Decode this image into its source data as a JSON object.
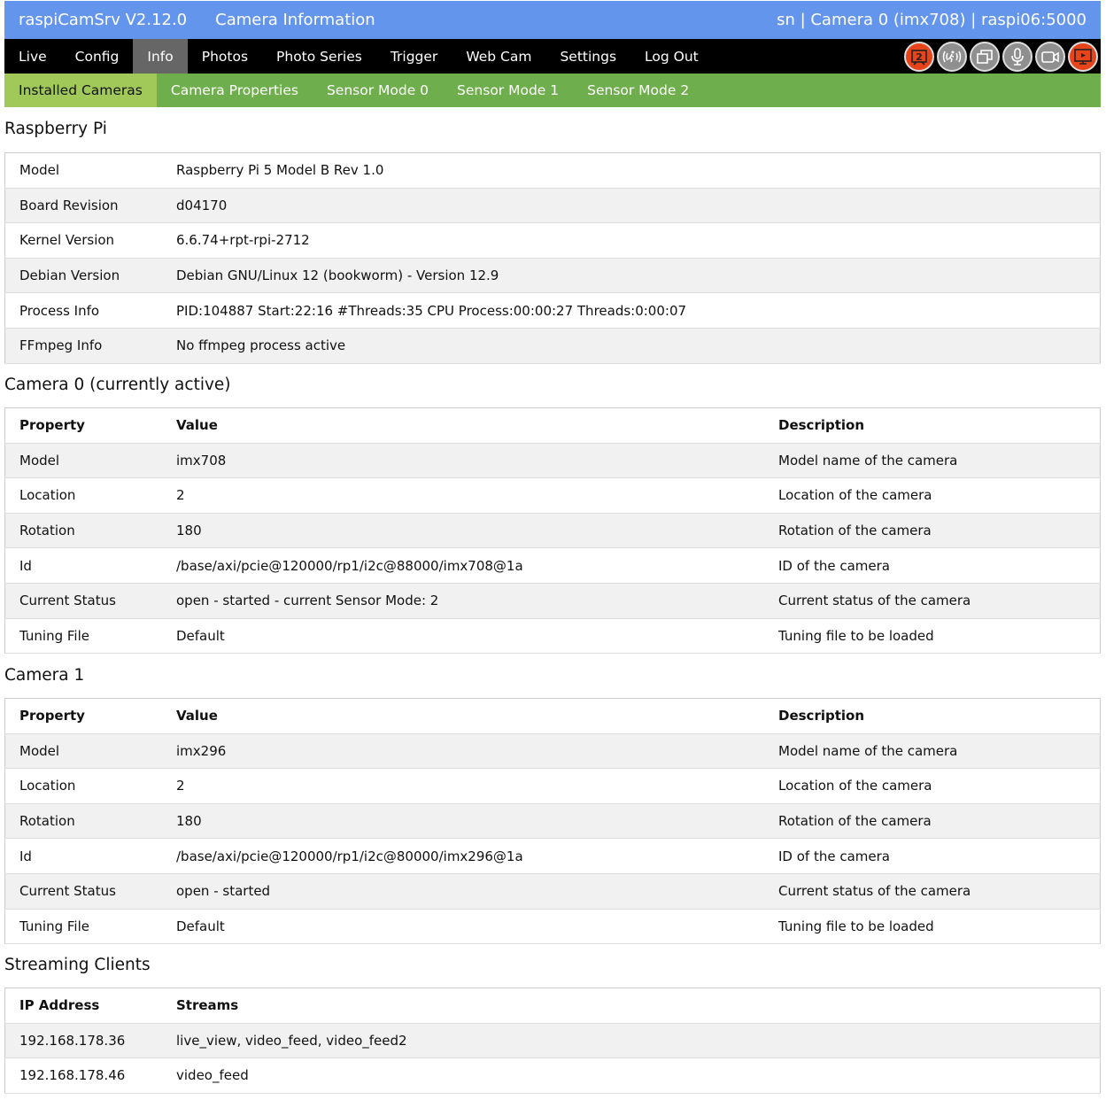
{
  "header": {
    "app_title": "raspiCamSrv V2.12.0",
    "page_title": "Camera Information",
    "status": "sn | Camera 0 (imx708) | raspi06:5000"
  },
  "nav": {
    "items": [
      "Live",
      "Config",
      "Info",
      "Photos",
      "Photo Series",
      "Trigger",
      "Web Cam",
      "Settings",
      "Log Out"
    ],
    "active": "Info",
    "icons": [
      "camera-count-2-icon",
      "motion-trigger-icon",
      "multi-camera-icon",
      "microphone-icon",
      "video-recording-icon",
      "streaming-screen-icon"
    ],
    "icon_badge": "2",
    "colors": {
      "red": "#e8441a",
      "gray": "#8f8f8f"
    }
  },
  "subnav": {
    "items": [
      "Installed Cameras",
      "Camera Properties",
      "Sensor Mode 0",
      "Sensor Mode 1",
      "Sensor Mode 2"
    ],
    "active": "Installed Cameras"
  },
  "raspberry_pi": {
    "title": "Raspberry Pi",
    "rows": [
      [
        "Model",
        "Raspberry Pi 5 Model B Rev 1.0"
      ],
      [
        "Board Revision",
        "d04170"
      ],
      [
        "Kernel Version",
        "6.6.74+rpt-rpi-2712"
      ],
      [
        "Debian Version",
        "Debian GNU/Linux 12 (bookworm) - Version 12.9"
      ],
      [
        "Process Info",
        "PID:104887 Start:22:16 #Threads:35 CPU Process:00:00:27 Threads:0:00:07"
      ],
      [
        "FFmpeg Info",
        "No ffmpeg process active"
      ]
    ]
  },
  "camera0": {
    "title": "Camera 0 (currently active)",
    "headers": [
      "Property",
      "Value",
      "Description"
    ],
    "rows": [
      [
        "Model",
        "imx708",
        "Model name of the camera"
      ],
      [
        "Location",
        "2",
        "Location of the camera"
      ],
      [
        "Rotation",
        "180",
        "Rotation of the camera"
      ],
      [
        "Id",
        "/base/axi/pcie@120000/rp1/i2c@88000/imx708@1a",
        "ID of the camera"
      ],
      [
        "Current Status",
        "open - started - current Sensor Mode: 2",
        "Current status of the camera"
      ],
      [
        "Tuning File",
        "Default",
        "Tuning file to be loaded"
      ]
    ]
  },
  "camera1": {
    "title": "Camera 1",
    "headers": [
      "Property",
      "Value",
      "Description"
    ],
    "rows": [
      [
        "Model",
        "imx296",
        "Model name of the camera"
      ],
      [
        "Location",
        "2",
        "Location of the camera"
      ],
      [
        "Rotation",
        "180",
        "Rotation of the camera"
      ],
      [
        "Id",
        "/base/axi/pcie@120000/rp1/i2c@80000/imx296@1a",
        "ID of the camera"
      ],
      [
        "Current Status",
        "open - started",
        "Current status of the camera"
      ],
      [
        "Tuning File",
        "Default",
        "Tuning file to be loaded"
      ]
    ]
  },
  "streaming": {
    "title": "Streaming Clients",
    "headers": [
      "IP Address",
      "Streams"
    ],
    "rows": [
      [
        "192.168.178.36",
        "live_view, video_feed, video_feed2"
      ],
      [
        "192.168.178.46",
        "video_feed"
      ]
    ]
  }
}
